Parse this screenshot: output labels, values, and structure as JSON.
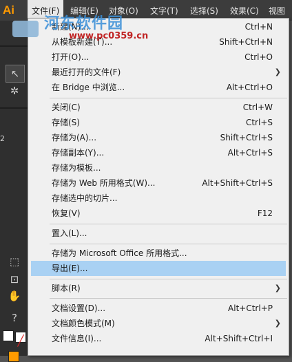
{
  "app": {
    "logo": "Ai"
  },
  "menubar": [
    {
      "label": "文件(F)",
      "active": true
    },
    {
      "label": "编辑(E)"
    },
    {
      "label": "对象(O)"
    },
    {
      "label": "文字(T)"
    },
    {
      "label": "选择(S)"
    },
    {
      "label": "效果(C)"
    },
    {
      "label": "视图("
    }
  ],
  "watermark": {
    "title": "河东软件园",
    "url": "www.pc0359.cn"
  },
  "tools": {
    "panel_number": "2",
    "help_glyph": "?"
  },
  "file_menu": [
    {
      "label": "新建(N)...",
      "shortcut": "Ctrl+N"
    },
    {
      "label": "从模板新建(T)...",
      "shortcut": "Shift+Ctrl+N"
    },
    {
      "label": "打开(O)...",
      "shortcut": "Ctrl+O"
    },
    {
      "label": "最近打开的文件(F)",
      "submenu": true
    },
    {
      "label": "在 Bridge 中浏览...",
      "shortcut": "Alt+Ctrl+O"
    },
    {
      "separator": true
    },
    {
      "label": "关闭(C)",
      "shortcut": "Ctrl+W"
    },
    {
      "label": "存储(S)",
      "shortcut": "Ctrl+S"
    },
    {
      "label": "存储为(A)...",
      "shortcut": "Shift+Ctrl+S"
    },
    {
      "label": "存储副本(Y)...",
      "shortcut": "Alt+Ctrl+S"
    },
    {
      "label": "存储为模板..."
    },
    {
      "label": "存储为 Web 所用格式(W)...",
      "shortcut": "Alt+Shift+Ctrl+S"
    },
    {
      "label": "存储选中的切片..."
    },
    {
      "label": "恢复(V)",
      "shortcut": "F12"
    },
    {
      "separator": true
    },
    {
      "label": "置入(L)..."
    },
    {
      "separator": true
    },
    {
      "label": "存储为 Microsoft Office 所用格式..."
    },
    {
      "label": "导出(E)...",
      "highlighted": true
    },
    {
      "separator": true
    },
    {
      "label": "脚本(R)",
      "submenu": true
    },
    {
      "separator": true
    },
    {
      "label": "文档设置(D)...",
      "shortcut": "Alt+Ctrl+P"
    },
    {
      "label": "文档颜色模式(M)",
      "submenu": true
    },
    {
      "label": "文件信息(I)...",
      "shortcut": "Alt+Shift+Ctrl+I"
    }
  ],
  "colors": {
    "highlight": "#a9d1f3",
    "menu_bg": "#f0f0f0",
    "app_bg": "#535353",
    "logo": "#ff9a00"
  }
}
